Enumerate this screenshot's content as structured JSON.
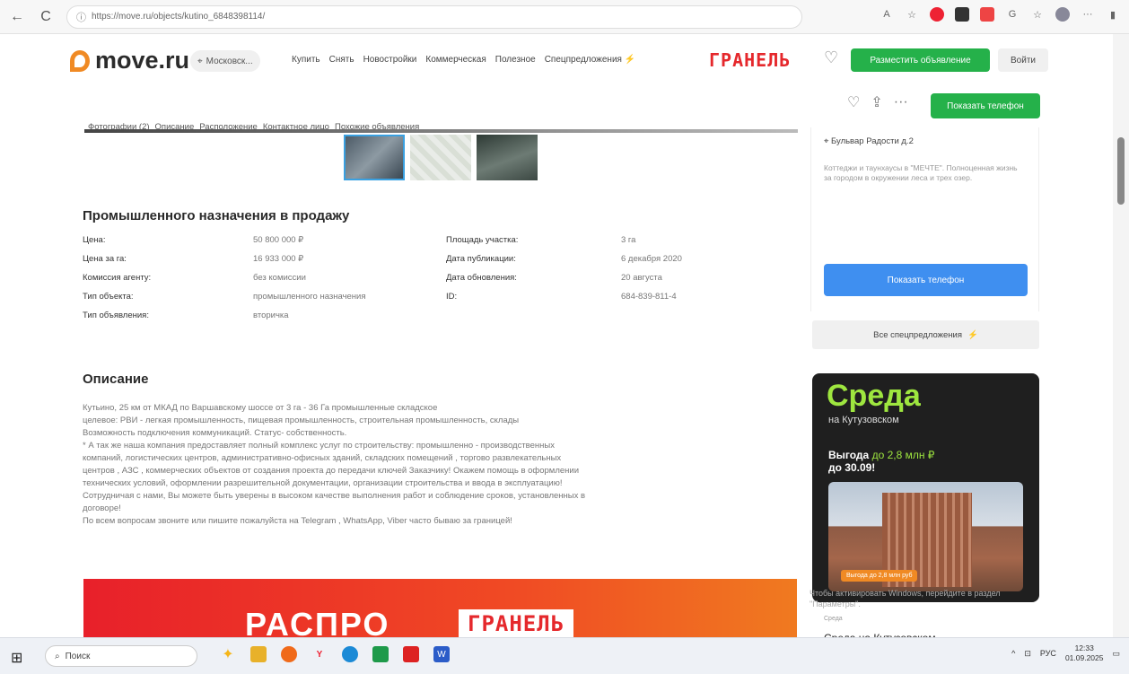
{
  "browser": {
    "url": "https://move.ru/objects/kutino_6848398114/",
    "back": "←",
    "refresh": "C"
  },
  "header": {
    "logo": "move.ru",
    "city": "Московск...",
    "menu": [
      "Купить",
      "Снять",
      "Новостройки",
      "Коммерческая",
      "Полезное",
      "Спецпредложения"
    ],
    "partner": "ГРАНЕЛЬ",
    "post_ad": "Разместить объявление",
    "login": "Войти"
  },
  "subnav": {
    "tabs": [
      "Фотографии (2)",
      "Описание",
      "Расположение",
      "Контактное лицо",
      "Похожие объявления"
    ],
    "show_phone": "Показать телефон"
  },
  "listing": {
    "title": "Промышленного назначения в продажу",
    "left": [
      {
        "k": "Цена:",
        "v": "50 800 000 ₽"
      },
      {
        "k": "Цена за га:",
        "v": "16 933 000 ₽"
      },
      {
        "k": "Комиссия агенту:",
        "v": "без комиссии"
      },
      {
        "k": "Тип объекта:",
        "v": "промышленного назначения"
      },
      {
        "k": "Тип объявления:",
        "v": "вторичка"
      }
    ],
    "right": [
      {
        "k": "Площадь участка:",
        "v": "3 га"
      },
      {
        "k": "Дата публикации:",
        "v": "6 декабря 2020"
      },
      {
        "k": "Дата обновления:",
        "v": "20 августа"
      },
      {
        "k": "ID:",
        "v": "684-839-811-4"
      }
    ]
  },
  "description": {
    "title": "Описание",
    "lines": [
      "Кутьино, 25 км от МКАД по Варшавскому шоссе от 3 га - 36 Га промышленные складское",
      "целевое: РВИ - легкая промышленность, пищевая промышленность, строительная промышленность, склады",
      "Возможность подключения коммуникаций. Статус- собственность.",
      "* А так же наша компания предоставляет полный комплекс услуг по строительству: промышленно - производственных",
      "компаний, логистических центров, административно-офисных зданий, складских помещений , торгово развлекательных",
      "центров , АЗС , коммерческих объектов от создания проекта до передачи ключей Заказчику! Окажем помощь в оформлении",
      "технических условий, оформлении разрешительной документации, организации строительства и ввода в эксплуатацию!",
      "Сотрудничая с нами, Вы можете быть уверены в высоком качестве выполнения работ и соблюдение сроков, установленных в",
      "договоре!",
      "По всем вопросам звоните или пишите пожалуйста на Telegram , WhatsApp, Viber часто бываю за границей!"
    ]
  },
  "banner": {
    "text1": "РАСПРО",
    "text2": "ГРАНЕЛЬ"
  },
  "sidebar": {
    "address": "Бульвар Радости д.2",
    "promo_text": "Коттеджи и таунхаусы в \"МЕЧТЕ\". Полноценная жизнь за городом в окружении леса и трех озер.",
    "show_phone": "Показать телефон",
    "all_offers": "Все спецпредложения"
  },
  "ad": {
    "brand": "Среда",
    "sub": "на Кутузовском",
    "offer_prefix": "Выгода ",
    "offer_green": "до 2,8 млн ₽",
    "offer_suffix": "до 30.09!",
    "badge": "Выгода до 2,8 млн руб",
    "watermark_line1": "Чтобы активировать Windows, перейдите в раздел",
    "watermark_line2": "\"Параметры\".",
    "footer_label": "Среда",
    "footer_title": "Среда на Кутузовском"
  },
  "taskbar": {
    "search": "Поиск",
    "lang": "РУС",
    "time": "12:33",
    "date": "01.09.2025"
  },
  "colors": {
    "green": "#25b14a",
    "blue": "#3f8ff0",
    "red": "#e5282c",
    "orange": "#f08a24"
  }
}
